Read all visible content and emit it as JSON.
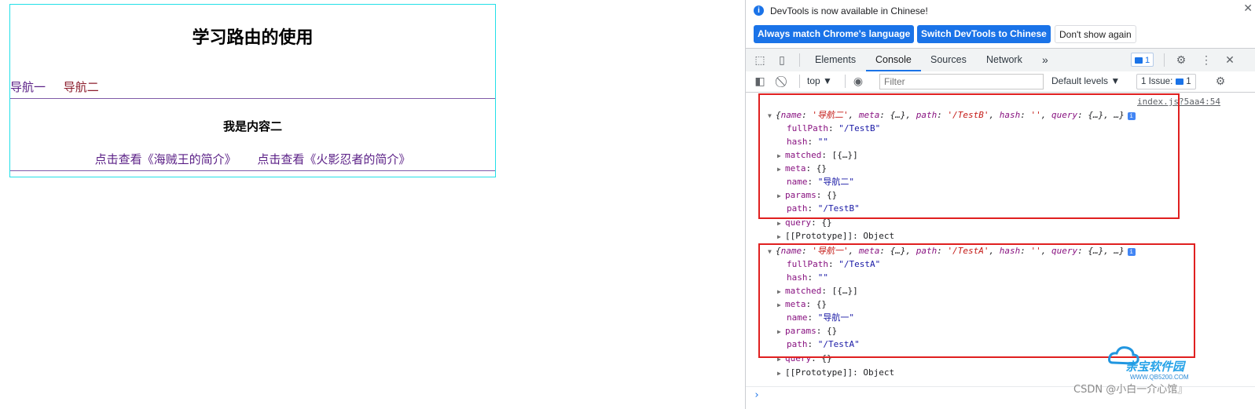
{
  "page": {
    "title": "学习路由的使用",
    "nav": [
      "导航一",
      "导航二"
    ],
    "content_title": "我是内容二",
    "links": [
      "点击查看《海贼王的简介》",
      "点击查看《火影忍者的简介》"
    ]
  },
  "devtools": {
    "infobar": {
      "message": "DevTools is now available in Chinese!",
      "btn_match": "Always match Chrome's language",
      "btn_switch": "Switch DevTools to Chinese",
      "btn_dismiss": "Don't show again"
    },
    "tabs": [
      "Elements",
      "Console",
      "Sources",
      "Network"
    ],
    "active_tab": "Console",
    "more_tabs": "»",
    "message_badge": "1",
    "toolbar": {
      "context": "top ▼",
      "filter_placeholder": "Filter",
      "levels": "Default levels ▼",
      "issues": "1 Issue:",
      "issues_count": "1"
    },
    "source_link": "index.js?5aa4:54",
    "logs": [
      {
        "summary_name": "导航二",
        "summary_path": "/TestB",
        "fullPath": "\"/TestB\"",
        "hash": "\"\"",
        "matched": "[{…}]",
        "meta": "{}",
        "name": "\"导航二\"",
        "params": "{}",
        "path": "\"/TestB\"",
        "query": "{}",
        "prototype": "Object"
      },
      {
        "summary_name": "导航一",
        "summary_path": "/TestA",
        "fullPath": "\"/TestA\"",
        "hash": "\"\"",
        "matched": "[{…}]",
        "meta": "{}",
        "name": "\"导航一\"",
        "params": "{}",
        "path": "\"/TestA\"",
        "query": "{}",
        "prototype": "Object"
      }
    ],
    "prompt": "›"
  },
  "watermark": {
    "brand": "亲宝软件园",
    "url": "WWW.QB5200.COM",
    "csdn": "CSDN @小白一介心馆』"
  },
  "colors": {
    "accent": "#1a73e8",
    "highlight_box": "#e02020",
    "app_border": "#22e0e8",
    "link": "#5a1f86"
  }
}
